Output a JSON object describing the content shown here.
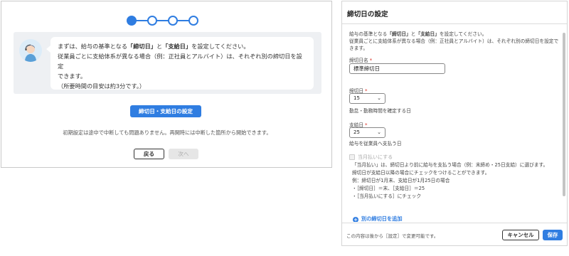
{
  "wizard": {
    "steps": [
      {
        "state": "active"
      },
      {
        "state": "inactive"
      },
      {
        "state": "inactive"
      },
      {
        "state": "inactive"
      }
    ],
    "message": {
      "line1_a": "まずは、給与の基準となる",
      "line1_bold1": "「締切日」",
      "line1_b": "と",
      "line1_bold2": "「支給日」",
      "line1_c": "を設定してください。",
      "line2": "従業員ごとに支給体系が異なる場合（例：正社員とアルバイト）は、それぞれ別の締切日を設定",
      "line3": "できます。",
      "line4": "（所要時間の目安は約3分です。）"
    },
    "setup_button": "締切日・支給日の設定",
    "note": "初期設定は途中で中断しても問題ありません。再開時には中断した箇所から開始できます。",
    "back_button": "戻る",
    "next_button": "次へ"
  },
  "dialog": {
    "title": "締切日の設定",
    "description_line1_a": "給与の基準となる",
    "description_line1_bold1": "「締切日」",
    "description_line1_b": "と",
    "description_line1_bold2": "「支給日」",
    "description_line1_c": "を設定してください。",
    "description_line2": "従業員ごとに支給体系が異なる場合（例：正社員とアルバイト）は、それぞれ別の締切日を設定で",
    "description_line3": "きます。",
    "closing_name_label": "締切日名",
    "closing_name_value": "標準締切日",
    "required_mark": "*",
    "closing_day_label": "締切日",
    "closing_day_value": "15",
    "closing_day_help": "勤怠・勤務時間を確定する日",
    "pay_day_label": "支給日",
    "pay_day_value": "25",
    "pay_day_help": "給与を従業員へ支払う日",
    "same_month_label": "当月払いにする",
    "same_month_help_line1": "「当月払い」は、締切日より前に給与を支払う場合（例：末締め・25日支給）に選びます。",
    "same_month_help_line2": "締切日が支給日以降の場合にチェックをつけることができます。",
    "same_month_help_line3": "例：締切日が1月末、支給日が1月25日の場合",
    "same_month_help_line4": "・［締切日］＝末、［支給日］＝25",
    "same_month_help_line5": "・［当月払いにする］にチェック",
    "add_closing_day": "別の締切日を追加",
    "footer_note": "この内容は後から［設定］で変更可能です。",
    "cancel_button": "キャンセル",
    "save_button": "保存"
  },
  "colors": {
    "primary": "#2f7de1",
    "required": "#d93025",
    "panel_bg": "#eef0f3"
  },
  "icons": {
    "avatar": "operator-avatar-icon",
    "chevron": "chevron-down-icon",
    "add": "plus-circle-icon"
  }
}
